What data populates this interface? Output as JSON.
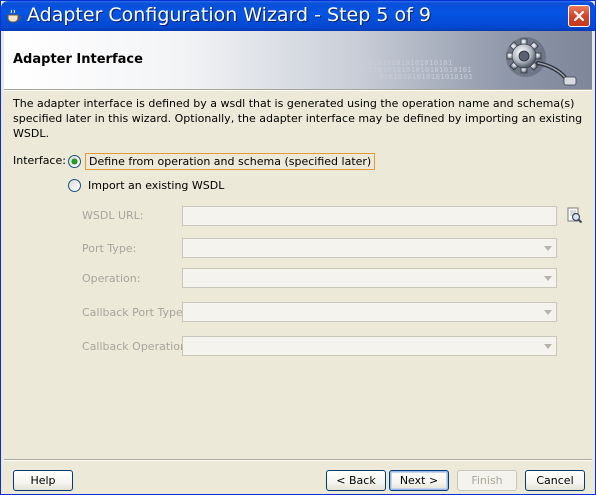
{
  "window": {
    "title": "Adapter Configuration Wizard - Step 5 of 9"
  },
  "header": {
    "title": "Adapter Interface",
    "binary_lines": [
      "0101010101010101010101",
      "010101010101010101010101",
      "01010101010101010101"
    ]
  },
  "description": "The adapter interface is defined by a wsdl that is generated using the operation name and schema(s) specified later in this wizard.  Optionally, the adapter interface may be defined by importing an existing WSDL.",
  "interface": {
    "label": "Interface:",
    "options": [
      {
        "label": "Define from operation and schema (specified later)",
        "selected": true
      },
      {
        "label": "Import an existing WSDL",
        "selected": false
      }
    ]
  },
  "fields": {
    "wsdl_url": {
      "label": "WSDL URL:",
      "value": ""
    },
    "port_type": {
      "label": "Port Type:",
      "value": ""
    },
    "operation": {
      "label": "Operation:",
      "value": ""
    },
    "callback_port_type": {
      "label": "Callback Port Type:",
      "value": ""
    },
    "callback_operation": {
      "label": "Callback Operation:",
      "value": ""
    }
  },
  "buttons": {
    "help": "Help",
    "back": "< Back",
    "next": "Next >",
    "finish": "Finish",
    "cancel": "Cancel"
  },
  "colors": {
    "titlebar": "#0554e3",
    "dialog_bg": "#ece9d8",
    "disabled_text": "#a7a59c",
    "radio_dot": "#21a121"
  }
}
